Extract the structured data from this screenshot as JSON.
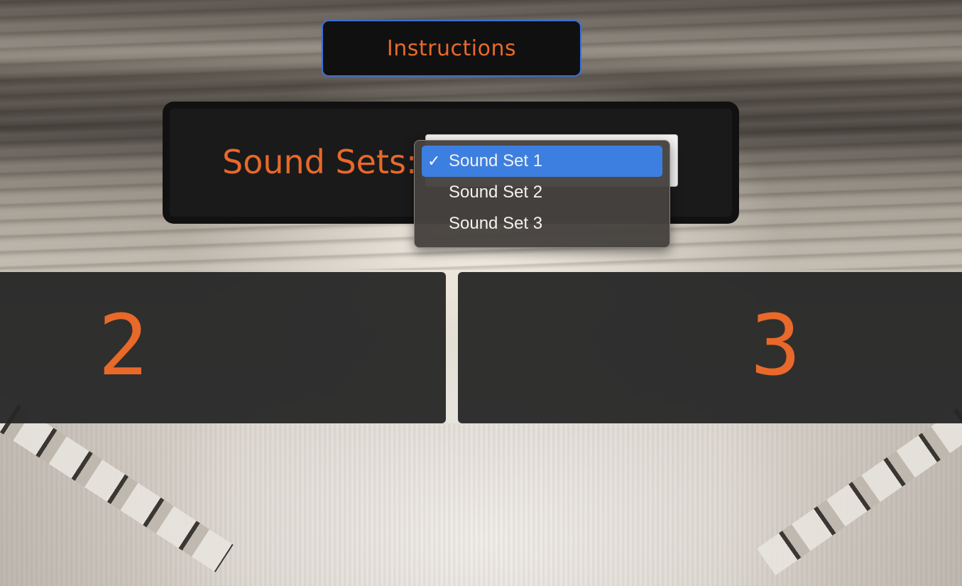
{
  "header": {
    "instructions_label": "Instructions"
  },
  "sound_sets": {
    "label": "Sound Sets:",
    "selected": "Sound Set 1",
    "options": [
      "Sound Set 1",
      "Sound Set 2",
      "Sound Set 3"
    ],
    "check_glyph": "✓"
  },
  "panels": [
    {
      "number": "2"
    },
    {
      "number": "3"
    }
  ],
  "colors": {
    "accent": "#e8692a",
    "selection": "#3d7fe0",
    "button_border": "#3b6fd6"
  }
}
